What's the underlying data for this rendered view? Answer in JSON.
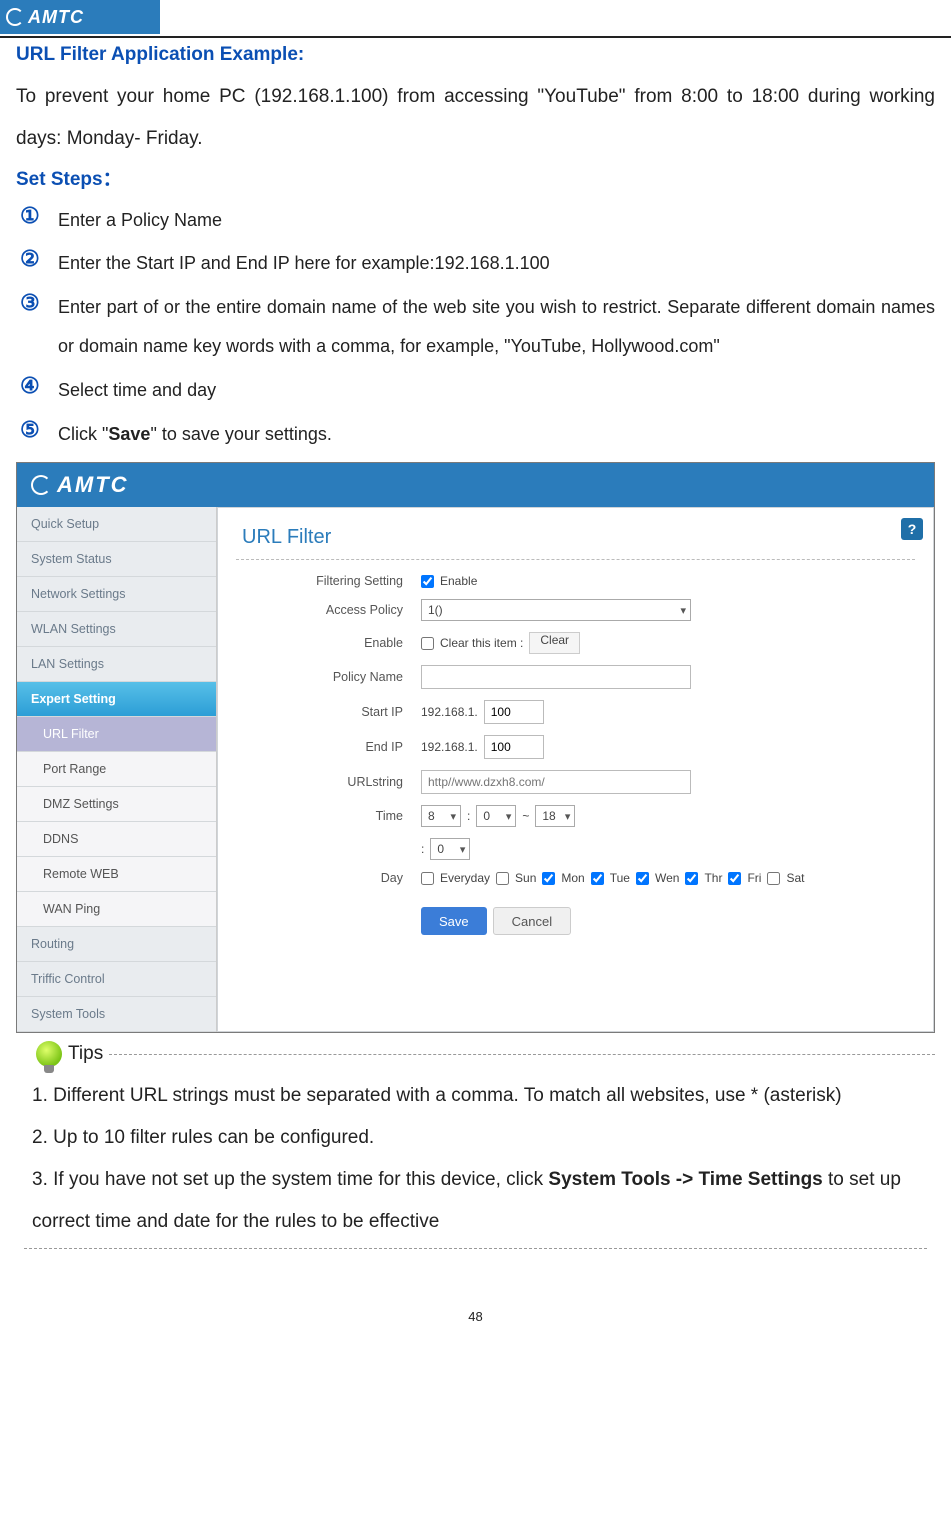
{
  "header": {
    "brand": "AMTC"
  },
  "section_title": "URL Filter Application Example:",
  "intro": "To prevent your home PC (192.168.1.100) from accessing \"YouTube\" from 8:00 to 18:00 during working days: Monday- Friday.",
  "steps_heading": "Set Steps：",
  "steps": {
    "n1": "①",
    "s1": "Enter a Policy Name",
    "n2": "②",
    "s2": "Enter the Start IP and End IP here for example:192.168.1.100",
    "n3": "③",
    "s3": "Enter part of or the entire domain name of the web site you wish to restrict. Separate different domain names or domain name key words with a comma, for example, \"YouTube, Hollywood.com\"",
    "n4": "④",
    "s4": "Select time and day",
    "n5": "⑤",
    "s5_pre": "Click \"",
    "s5_bold": "Save",
    "s5_post": "\" to save your settings."
  },
  "ui": {
    "brand": "AMTC",
    "help": "?",
    "title": "URL Filter",
    "sidebar": {
      "quick_setup": "Quick Setup",
      "system_status": "System Status",
      "network_settings": "Network Settings",
      "wlan_settings": "WLAN Settings",
      "lan_settings": "LAN Settings",
      "expert_setting": "Expert Setting",
      "url_filter": "URL Filter",
      "port_range": "Port Range",
      "dmz": "DMZ Settings",
      "ddns": "DDNS",
      "remote_web": "Remote WEB",
      "wan_ping": "WAN Ping",
      "routing": "Routing",
      "traffic": "Triffic Control",
      "system_tools": "System Tools"
    },
    "labels": {
      "filtering": "Filtering Setting",
      "access_policy": "Access Policy",
      "enable": "Enable",
      "policy_name": "Policy Name",
      "start_ip": "Start IP",
      "end_ip": "End IP",
      "url": "URLstring",
      "time": "Time",
      "day": "Day"
    },
    "values": {
      "enable_label": "Enable",
      "policy_select": "1()",
      "clear_label": "Clear this item :",
      "clear_btn": "Clear",
      "ip_prefix": "192.168.1.",
      "start_ip": "100",
      "end_ip": "100",
      "url_placeholder": "http//www.dzxh8.com/",
      "time_h1": "8",
      "time_m1": "0",
      "time_h2": "18",
      "time_m2": "0",
      "sep_colon": ":",
      "sep_tilde": "~",
      "days": {
        "every": "Everyday",
        "sun": "Sun",
        "mon": "Mon",
        "tue": "Tue",
        "wen": "Wen",
        "thr": "Thr",
        "fri": "Fri",
        "sat": "Sat"
      },
      "save": "Save",
      "cancel": "Cancel"
    },
    "checks": {
      "filtering": true,
      "clear": false,
      "every": false,
      "sun": false,
      "mon": true,
      "tue": true,
      "wen": true,
      "thr": true,
      "fri": true,
      "sat": false
    }
  },
  "tips_label": "Tips",
  "tips": {
    "t1": "1. Different URL strings must be separated with a comma. To match all websites, use * (asterisk)",
    "t2": "2. Up to 10 filter rules can be configured.",
    "t3_pre": "3. If you have not set up the system time for this device, click ",
    "t3_bold": "System Tools -> Time Settings",
    "t3_post": " to set up correct time and date for the rules to be effective"
  },
  "page_number": "48"
}
